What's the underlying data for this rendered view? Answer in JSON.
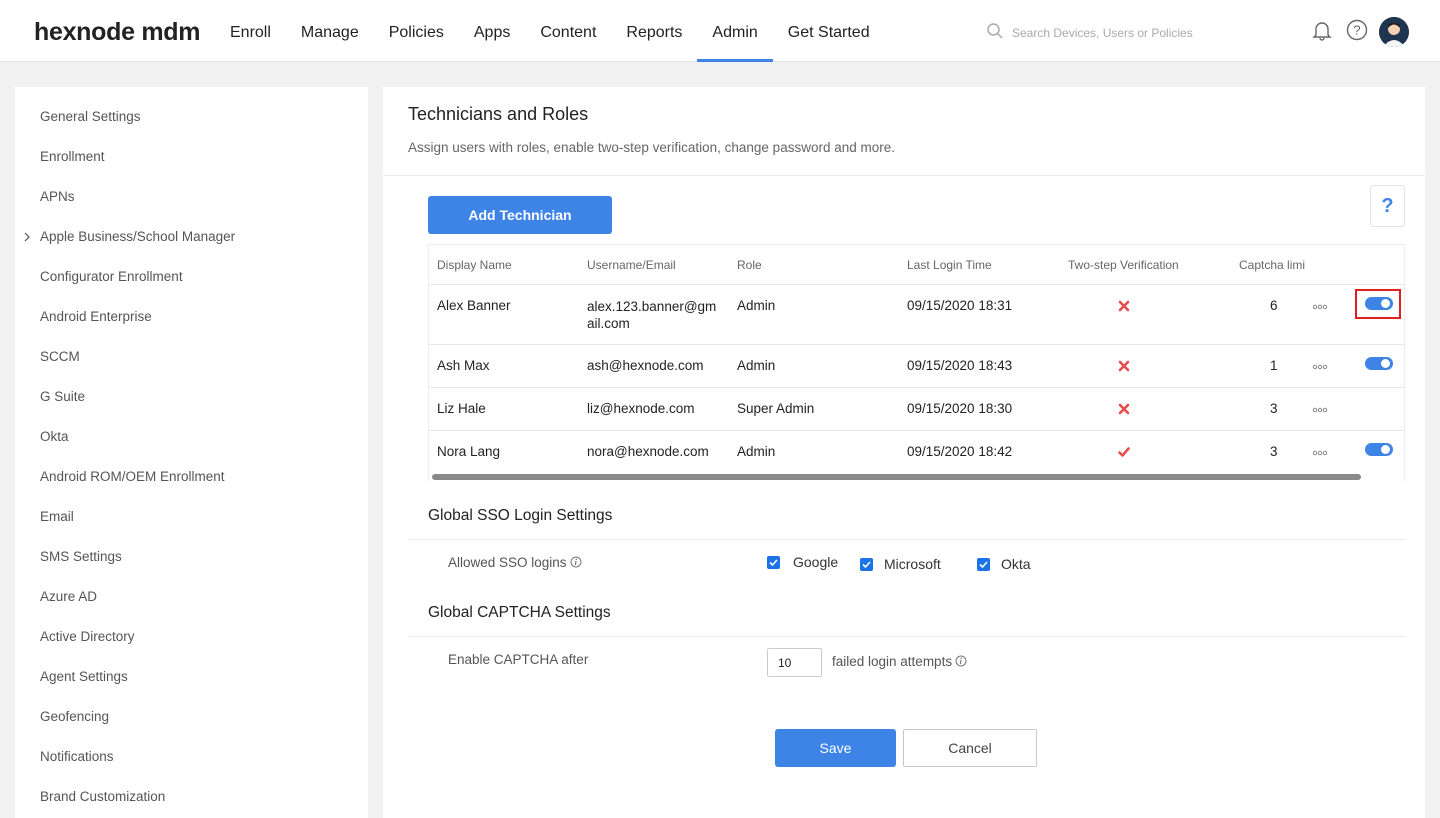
{
  "header": {
    "logo": "hexnode mdm",
    "nav": [
      "Enroll",
      "Manage",
      "Policies",
      "Apps",
      "Content",
      "Reports",
      "Admin",
      "Get Started"
    ],
    "active_nav": "Admin",
    "search_placeholder": "Search Devices, Users or Policies"
  },
  "sidebar": {
    "items": [
      "General Settings",
      "Enrollment",
      "APNs",
      "Apple Business/School Manager",
      "Configurator Enrollment",
      "Android Enterprise",
      "SCCM",
      "G Suite",
      "Okta",
      "Android ROM/OEM Enrollment",
      "Email",
      "SMS Settings",
      "Azure AD",
      "Active Directory",
      "Agent Settings",
      "Geofencing",
      "Notifications",
      "Brand Customization"
    ]
  },
  "main": {
    "title": "Technicians and Roles",
    "subtitle": "Assign users with roles, enable two-step verification, change password and more.",
    "help": "?",
    "add_button": "Add Technician",
    "table": {
      "columns": [
        "Display Name",
        "Username/Email",
        "Role",
        "Last Login Time",
        "Two-step Verification",
        "Captcha limi"
      ],
      "rows": [
        {
          "name": "Alex Banner",
          "email": "alex.123.banner@gmail.com",
          "role": "Admin",
          "last_login": "09/15/2020 18:31",
          "two_step": false,
          "captcha": "6",
          "toggle": true
        },
        {
          "name": "Ash Max",
          "email": "ash@hexnode.com",
          "role": "Admin",
          "last_login": "09/15/2020 18:43",
          "two_step": false,
          "captcha": "1",
          "toggle": true
        },
        {
          "name": "Liz Hale",
          "email": "liz@hexnode.com",
          "role": "Super Admin",
          "last_login": "09/15/2020 18:30",
          "two_step": false,
          "captcha": "3",
          "toggle": false
        },
        {
          "name": "Nora Lang",
          "email": "nora@hexnode.com",
          "role": "Admin",
          "last_login": "09/15/2020 18:42",
          "two_step": true,
          "captcha": "3",
          "toggle": true
        }
      ]
    },
    "sso": {
      "title": "Global SSO Login Settings",
      "label": "Allowed SSO logins",
      "options": [
        "Google",
        "Microsoft",
        "Okta"
      ]
    },
    "captcha": {
      "title": "Global CAPTCHA Settings",
      "label": "Enable CAPTCHA after",
      "value": "10",
      "suffix": "failed login attempts"
    },
    "save": "Save",
    "cancel": "Cancel"
  },
  "colors": {
    "accent": "#3d84e6",
    "error": "#e74c4c",
    "highlight": "#e02020"
  }
}
